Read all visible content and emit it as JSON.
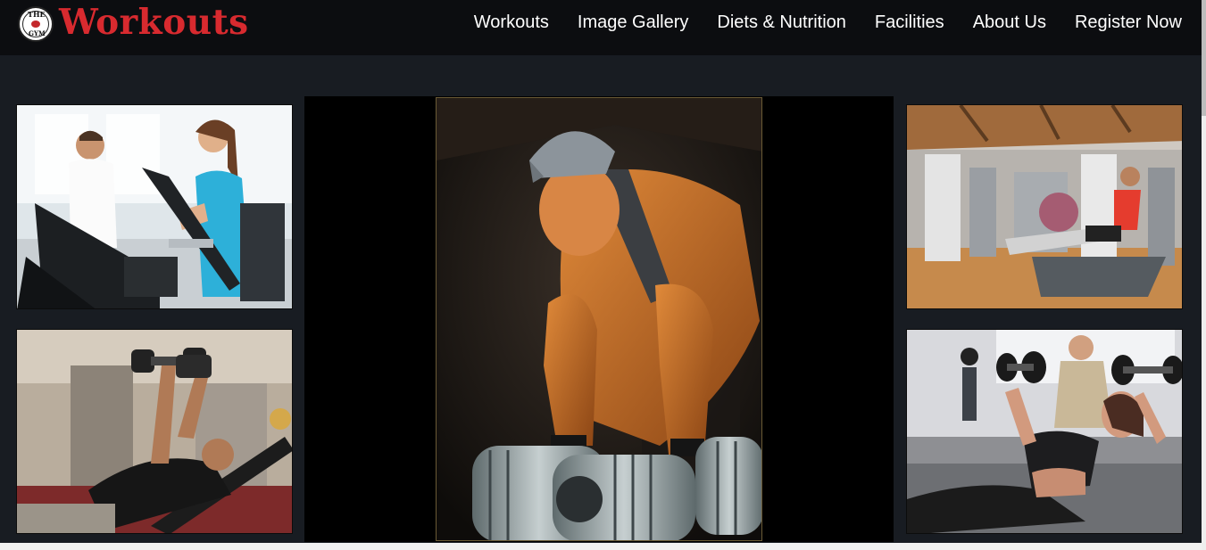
{
  "header": {
    "logo": {
      "icon": "the-gym-logo-icon",
      "text_top": "THE",
      "text_bottom": "GYM"
    },
    "brand": "Workouts"
  },
  "nav": [
    {
      "label": "Workouts"
    },
    {
      "label": "Image Gallery"
    },
    {
      "label": "Diets & Nutrition"
    },
    {
      "label": "Facilities"
    },
    {
      "label": "About Us"
    },
    {
      "label": "Register Now"
    }
  ],
  "colors": {
    "header_bg": "#0c0d10",
    "page_bg": "#181c22",
    "brand_red": "#d82a2f",
    "nav_text": "#ffffff"
  },
  "gallery": {
    "images": [
      {
        "icon": "elliptical-trainer-photo"
      },
      {
        "icon": "dumbbell-bench-press-photo"
      },
      {
        "icon": "bodybuilder-dumbbell-photo"
      },
      {
        "icon": "leg-press-machine-photo"
      },
      {
        "icon": "woman-dumbbell-press-photo"
      }
    ]
  }
}
